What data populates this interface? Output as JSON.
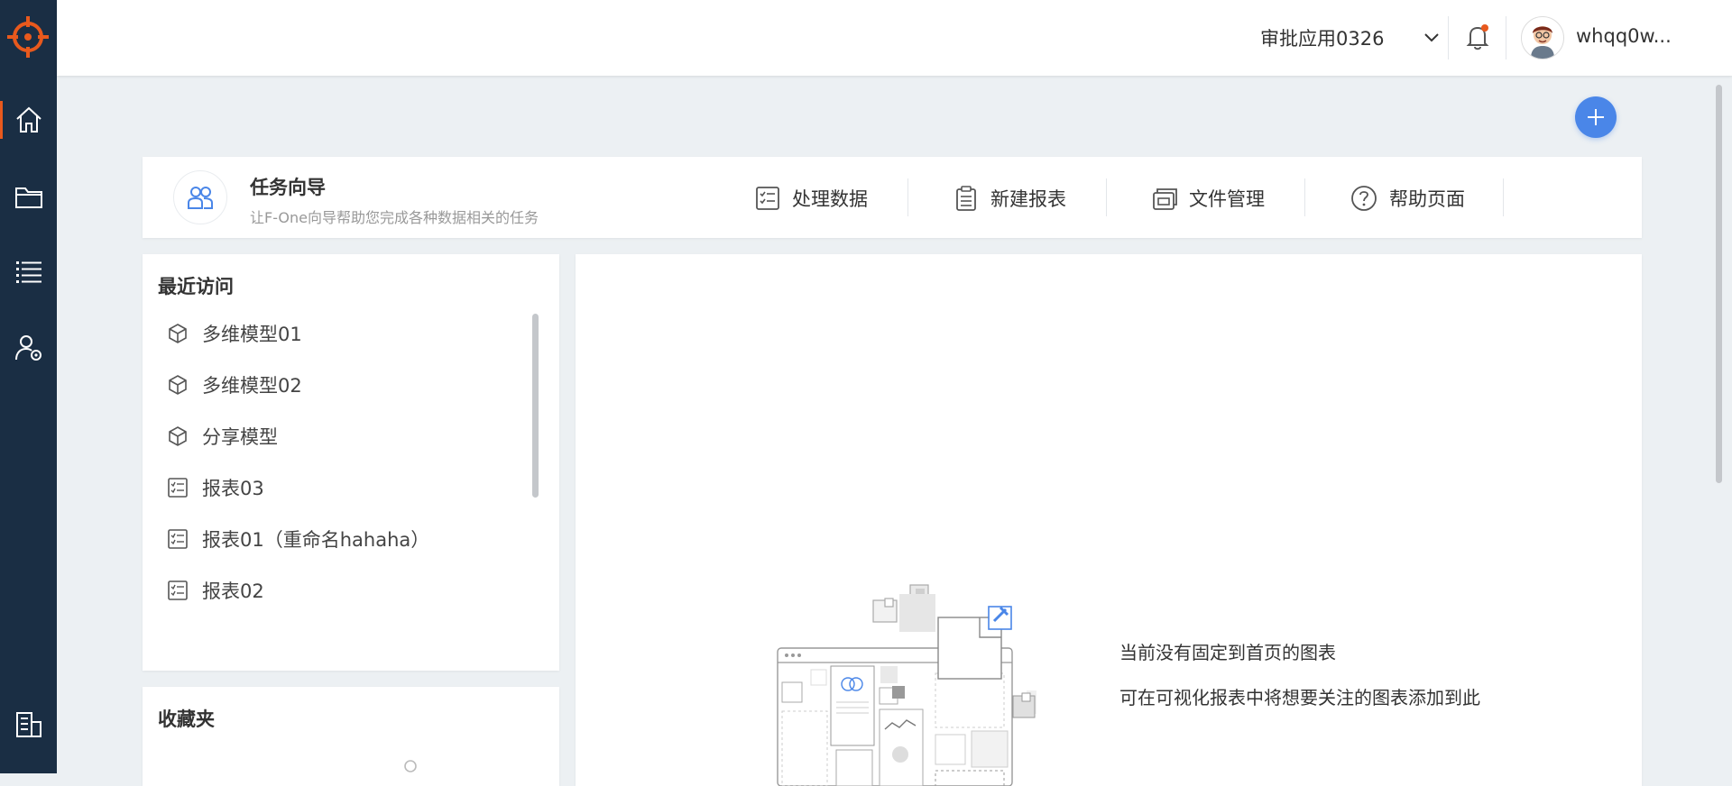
{
  "header": {
    "app_name": "审批应用0326",
    "username": "whqq0w..."
  },
  "colors": {
    "sidebar": "#1a2e44",
    "accent": "#e8591d",
    "primary": "#4a86e8"
  },
  "sidebar": {
    "items": [
      {
        "icon": "home-icon",
        "active": true
      },
      {
        "icon": "folder-icon",
        "active": false
      },
      {
        "icon": "list-icon",
        "active": false
      },
      {
        "icon": "user-settings-icon",
        "active": false
      },
      {
        "icon": "building-icon",
        "active": false
      }
    ]
  },
  "task_guide": {
    "title": "任务向导",
    "subtitle": "让F-One向导帮助您完成各种数据相关的任务",
    "actions": [
      {
        "label": "处理数据",
        "icon": "process-data-icon"
      },
      {
        "label": "新建报表",
        "icon": "new-report-icon"
      },
      {
        "label": "文件管理",
        "icon": "file-management-icon"
      },
      {
        "label": "帮助页面",
        "icon": "help-icon"
      }
    ]
  },
  "recent": {
    "title": "最近访问",
    "items": [
      {
        "label": "多维模型01",
        "icon": "cube-icon"
      },
      {
        "label": "多维模型02",
        "icon": "cube-icon"
      },
      {
        "label": "分享模型",
        "icon": "cube-icon"
      },
      {
        "label": "报表03",
        "icon": "report-icon"
      },
      {
        "label": "报表01（重命名hahaha）",
        "icon": "report-icon"
      },
      {
        "label": "报表02",
        "icon": "report-icon"
      }
    ]
  },
  "favorites": {
    "title": "收藏夹"
  },
  "dashboard": {
    "empty_title": "当前没有固定到首页的图表",
    "empty_hint": "可在可视化报表中将想要关注的图表添加到此"
  }
}
